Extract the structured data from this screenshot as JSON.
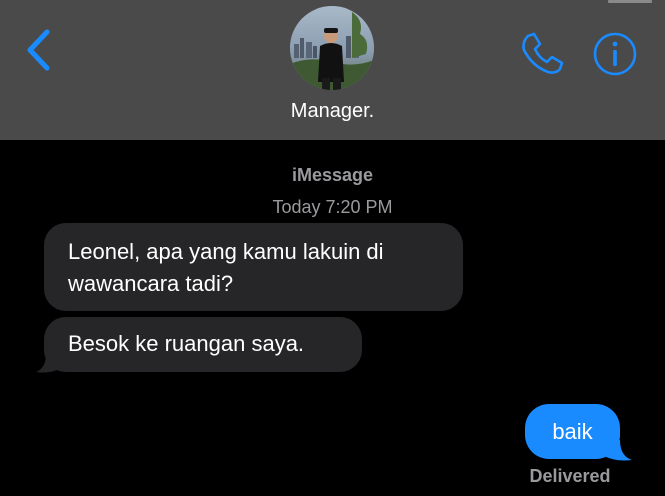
{
  "header": {
    "contact_name": "Manager.",
    "back_icon": "chevron-left-icon",
    "call_icon": "phone-icon",
    "info_icon": "info-icon"
  },
  "conversation": {
    "service_label": "iMessage",
    "timestamp": "Today 7:20 PM",
    "messages": [
      {
        "direction": "incoming",
        "text_line1": "Leonel, apa yang kamu lakuin di",
        "text_line2": "wawancara tadi?"
      },
      {
        "direction": "incoming",
        "text": "Besok ke ruangan saya."
      },
      {
        "direction": "outgoing",
        "text": "baik",
        "status": "Delivered"
      }
    ]
  },
  "colors": {
    "header_bg": "#4a4a4a",
    "accent": "#1a8bff",
    "incoming_bubble": "#262628",
    "secondary_text": "#9a9a9e"
  }
}
